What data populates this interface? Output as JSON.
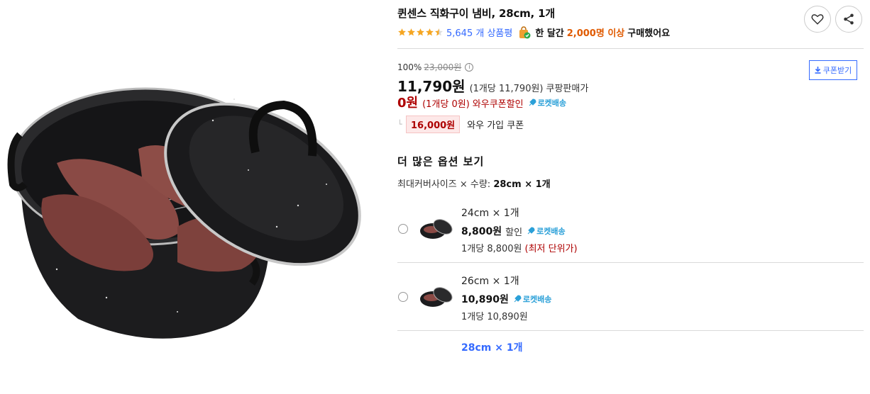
{
  "product": {
    "title": "퀸센스 직화구이 냄비, 28cm, 1개",
    "rating": 4.5,
    "review_count": "5,645 개 상품평",
    "purchase_prefix": "한 달간",
    "purchase_count": "2,000명 이상",
    "purchase_suffix": "구매했어요"
  },
  "icons": {
    "wish": "heart-icon",
    "share": "share-icon",
    "info": "info-icon",
    "download": "download-icon",
    "rocket": "rocket-icon",
    "bag": "shopping-bag-icon"
  },
  "price": {
    "discount_rate": "100%",
    "original": "23,000원",
    "info_glyph": "i",
    "coupon_button": "쿠폰받기",
    "sale": "11,790원",
    "sale_unit": "(1개당 11,790원)",
    "sale_type": "쿠팡판매가",
    "wow": "0원",
    "wow_unit": "(1개당 0원)",
    "wow_label": "와우쿠폰할인",
    "rocket_label": "로켓배송",
    "join_branch": "└",
    "join_amount": "16,000원",
    "join_label": "와우 가입 쿠폰"
  },
  "options": {
    "title": "더 많은 옵션 보기",
    "selected_label": "최대커버사이즈 × 수량:",
    "selected_value": "28cm × 1개",
    "items": [
      {
        "name": "24cm × 1개",
        "price": "8,800원",
        "discount": "할인",
        "rocket": "로켓배송",
        "unit": "1개당 8,800원",
        "note": "(최저 단위가)"
      },
      {
        "name": "26cm × 1개",
        "price": "10,890원",
        "discount": "",
        "rocket": "로켓배송",
        "unit": "1개당 10,890원",
        "note": ""
      },
      {
        "name": "28cm × 1개"
      }
    ]
  },
  "colors": {
    "accent_blue": "#346aff",
    "wow_red": "#ae0000",
    "purchase_orange": "#e05a00",
    "rocket_blue": "#2ba0d8",
    "star": "#f5a623"
  }
}
